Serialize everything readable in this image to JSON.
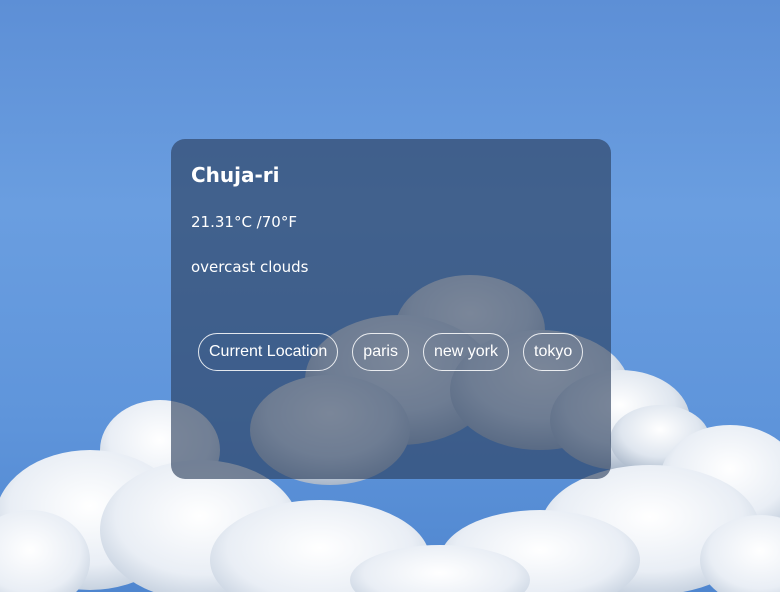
{
  "weather": {
    "city": "Chuja-ri",
    "temperature": "21.31°C /70°F",
    "description": "overcast clouds"
  },
  "locations": [
    {
      "label": "Current Location"
    },
    {
      "label": "paris"
    },
    {
      "label": "new york"
    },
    {
      "label": "tokyo"
    }
  ],
  "colors": {
    "sky": "#5f95db",
    "card_overlay": "#283c5a",
    "text": "#ffffff"
  }
}
